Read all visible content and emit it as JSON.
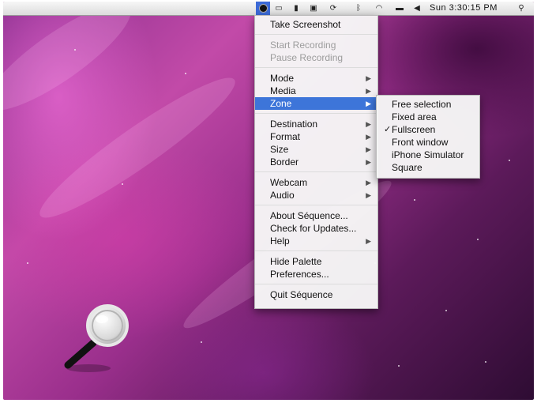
{
  "menubar": {
    "app_icon": "sequence-app-icon",
    "icons": [
      "fullscreen-icon",
      "document-icon",
      "display-icon",
      "sync-icon",
      "bluetooth-icon",
      "wifi-icon",
      "battery-icon",
      "volume-icon",
      "spotlight-icon"
    ],
    "clock": "Sun 3:30:15 PM"
  },
  "menu": {
    "items": [
      {
        "label": "Take Screenshot"
      },
      {
        "label": "Start Recording"
      },
      {
        "label": "Pause Recording"
      },
      {
        "label": "Mode"
      },
      {
        "label": "Media"
      },
      {
        "label": "Zone"
      },
      {
        "label": "Destination"
      },
      {
        "label": "Format"
      },
      {
        "label": "Size"
      },
      {
        "label": "Border"
      },
      {
        "label": "Webcam"
      },
      {
        "label": "Audio"
      },
      {
        "label": "About Séquence..."
      },
      {
        "label": "Check for Updates..."
      },
      {
        "label": "Help"
      },
      {
        "label": "Hide Palette"
      },
      {
        "label": "Preferences..."
      },
      {
        "label": "Quit Séquence"
      }
    ],
    "arrow": "▶"
  },
  "submenu": {
    "check_glyph": "✓",
    "items": [
      {
        "label": "Free selection"
      },
      {
        "label": "Fixed area"
      },
      {
        "label": "Fullscreen",
        "checked": true
      },
      {
        "label": "Front window"
      },
      {
        "label": "iPhone Simulator"
      },
      {
        "label": "Square"
      }
    ]
  },
  "colors": {
    "highlight": "#3d75d9",
    "menubar_app_icon_bg": "#3b69d6"
  }
}
